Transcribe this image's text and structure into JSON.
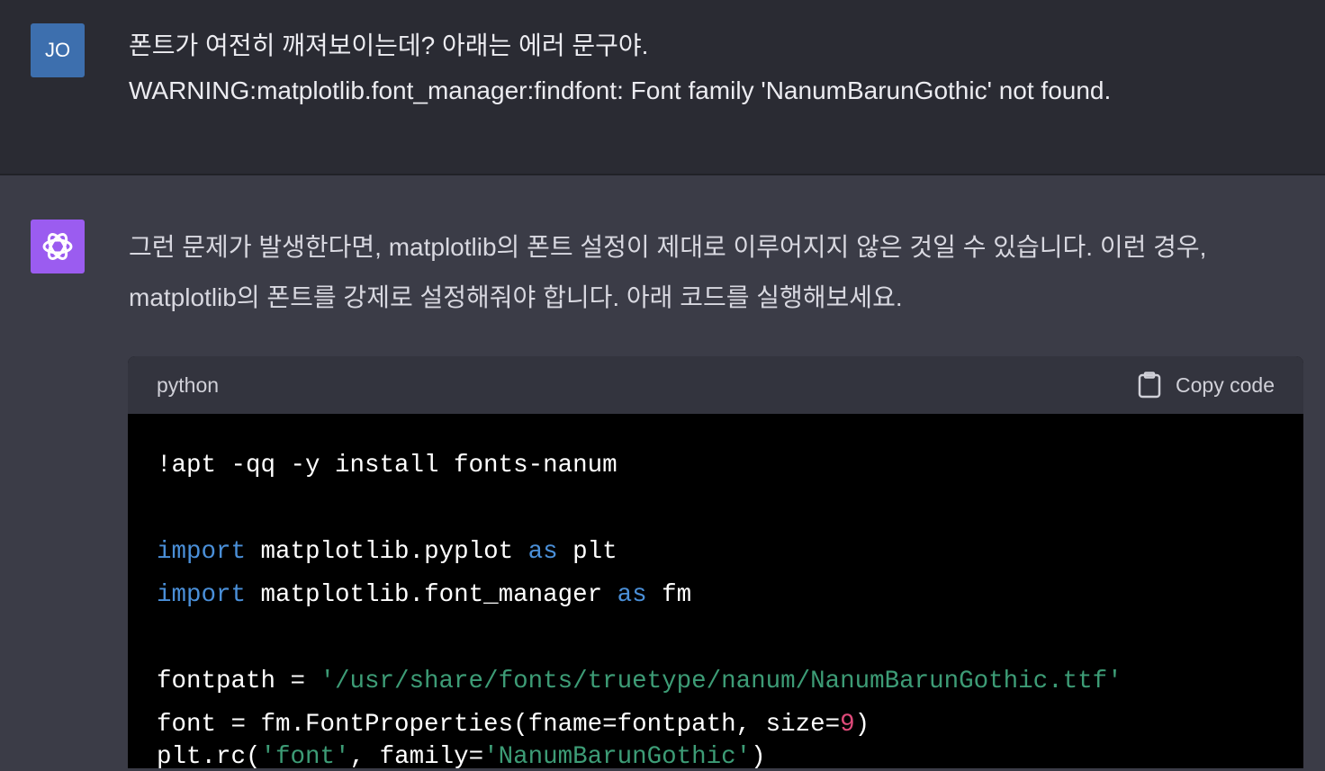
{
  "user": {
    "avatar": "JO",
    "lines": [
      "폰트가 여전히 깨져보이는데? 아래는 에러 문구야.",
      "WARNING:matplotlib.font_manager:findfont: Font family 'NanumBarunGothic' not found."
    ]
  },
  "assistant": {
    "avatar_icon": "openai-logo-icon",
    "lines": [
      "그런 문제가 발생한다면, matplotlib의 폰트 설정이 제대로 이루어지지 않은 것일 수 있습니다. 이런 경우,",
      "matplotlib의 폰트를 강제로 설정해줘야 합니다. 아래 코드를 실행해보세요."
    ]
  },
  "code": {
    "language": "python",
    "copy_label": "Copy code",
    "l1": "!apt -qq -y install fonts-nanum",
    "import": "import",
    "as": "as",
    "m1": " matplotlib.pyplot ",
    "a1": " plt",
    "m2": " matplotlib.font_manager ",
    "a2": " fm",
    "fp1": "fontpath = ",
    "fp2": "'/usr/share/fonts/truetype/nanum/NanumBarunGothic.ttf'",
    "f1": "font = fm.FontProperties(fname=fontpath, size=",
    "f2": "9",
    "f3": ")",
    "r1": "plt.rc(",
    "r2": "'font'",
    "r3": ", family=",
    "r4": "'NanumBarunGothic'",
    "r5": ")"
  },
  "colors": {
    "keyword": "#4a8fd8",
    "string": "#3d9c76",
    "number": "#e04a7a"
  }
}
